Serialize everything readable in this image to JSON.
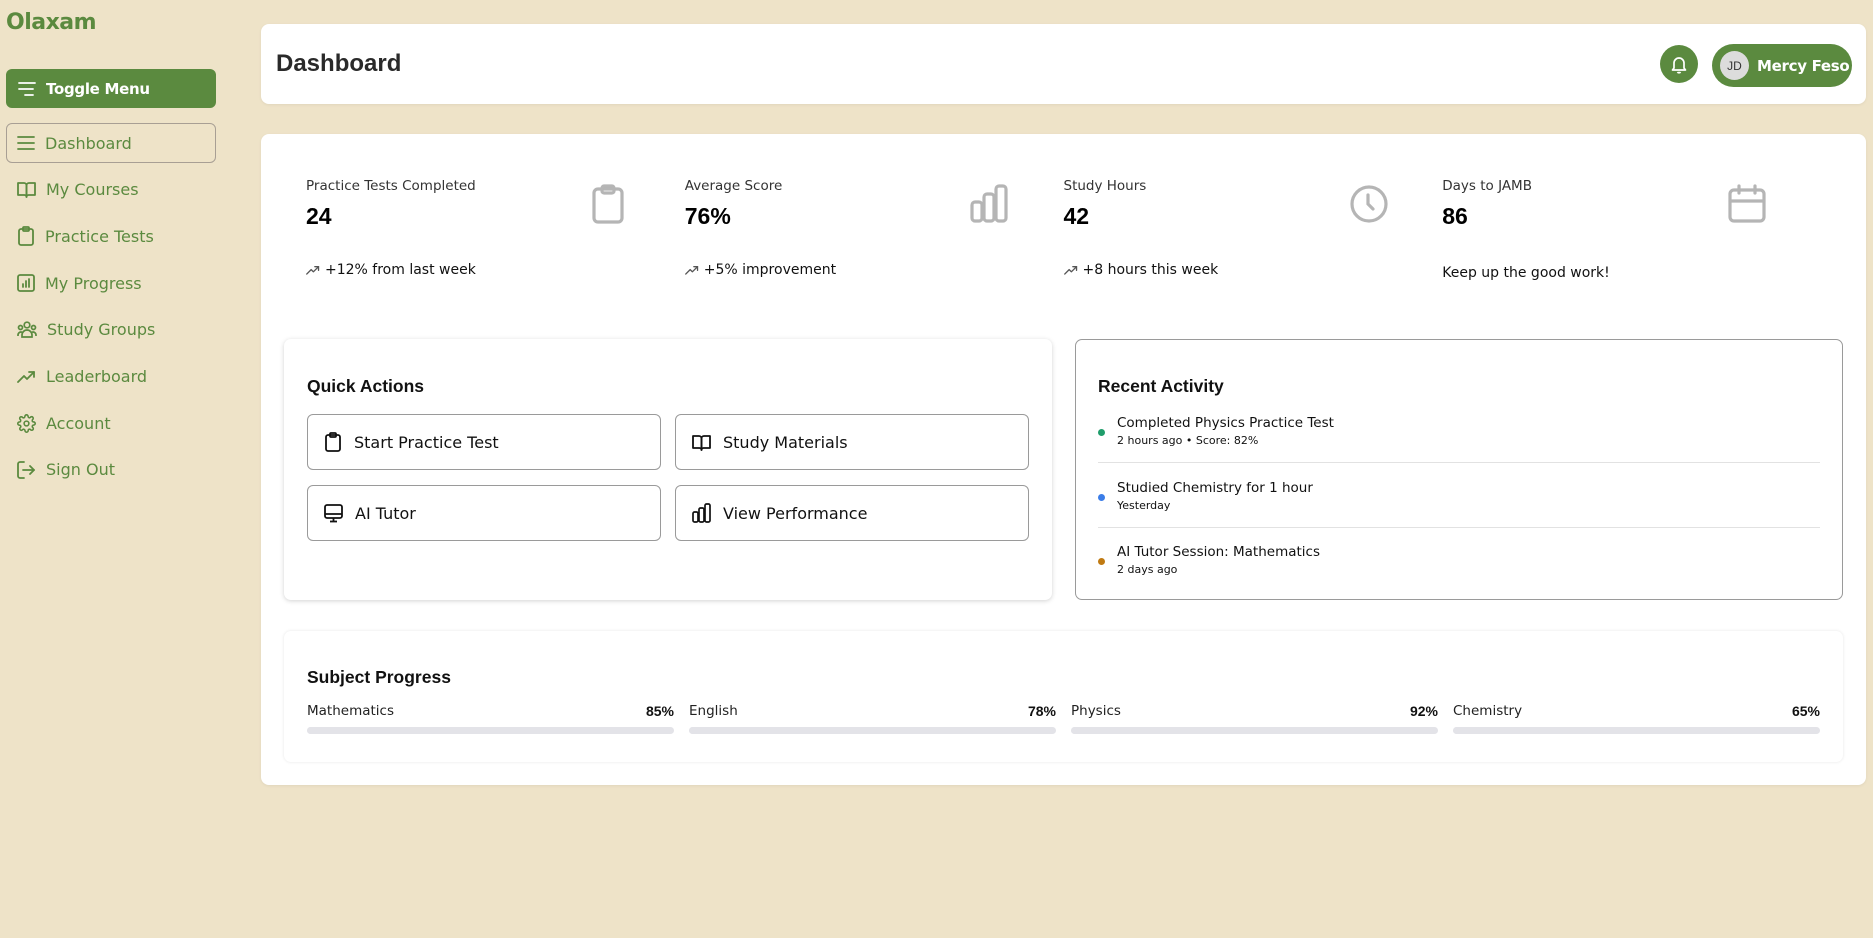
{
  "app": {
    "logo": "Olaxam"
  },
  "sidebar": {
    "toggle_label": "Toggle Menu",
    "items": [
      {
        "label": "Dashboard",
        "icon": "menu-icon",
        "active": true
      },
      {
        "label": "My Courses",
        "icon": "book-icon"
      },
      {
        "label": "Practice Tests",
        "icon": "clipboard-icon"
      },
      {
        "label": "My Progress",
        "icon": "bar-chart-icon"
      },
      {
        "label": "Study Groups",
        "icon": "users-icon"
      },
      {
        "label": "Leaderboard",
        "icon": "trending-up-icon"
      },
      {
        "label": "Account",
        "icon": "gear-icon"
      },
      {
        "label": "Sign Out",
        "icon": "sign-out-icon"
      }
    ]
  },
  "header": {
    "title": "Dashboard",
    "user": {
      "initials": "JD",
      "name": "Mercy Feso"
    }
  },
  "stats": [
    {
      "label": "Practice Tests Completed",
      "value": "24",
      "trend": "+12% from last week",
      "icon": "clipboard-icon"
    },
    {
      "label": "Average Score",
      "value": "76%",
      "trend": "+5% improvement",
      "icon": "bar-chart-icon"
    },
    {
      "label": "Study Hours",
      "value": "42",
      "trend": "+8 hours this week",
      "icon": "clock-icon"
    },
    {
      "label": "Days to JAMB",
      "value": "86",
      "note": "Keep up the good work!",
      "icon": "calendar-icon"
    }
  ],
  "quick_actions": {
    "title": "Quick Actions",
    "buttons": [
      {
        "label": "Start Practice Test",
        "icon": "clipboard-icon"
      },
      {
        "label": "Study Materials",
        "icon": "book-icon"
      },
      {
        "label": "AI Tutor",
        "icon": "monitor-icon"
      },
      {
        "label": "View Performance",
        "icon": "bar-chart-icon"
      }
    ]
  },
  "recent_activity": {
    "title": "Recent Activity",
    "items": [
      {
        "title": "Completed Physics Practice Test",
        "sub": "2 hours ago • Score: 82%",
        "color": "#1f9d6b"
      },
      {
        "title": "Studied Chemistry for 1 hour",
        "sub": "Yesterday",
        "color": "#3b7de8"
      },
      {
        "title": "AI Tutor Session: Mathematics",
        "sub": "2 days ago",
        "color": "#c07a12"
      }
    ]
  },
  "subject_progress": {
    "title": "Subject Progress",
    "items": [
      {
        "name": "Mathematics",
        "percent_label": "85%",
        "percent": 85
      },
      {
        "name": "English",
        "percent_label": "78%",
        "percent": 78
      },
      {
        "name": "Physics",
        "percent_label": "92%",
        "percent": 92
      },
      {
        "name": "Chemistry",
        "percent_label": "65%",
        "percent": 65
      }
    ]
  },
  "colors": {
    "brand": "#5b8a3f",
    "background": "#eee3c8",
    "icon_muted": "#b5b5b5"
  }
}
